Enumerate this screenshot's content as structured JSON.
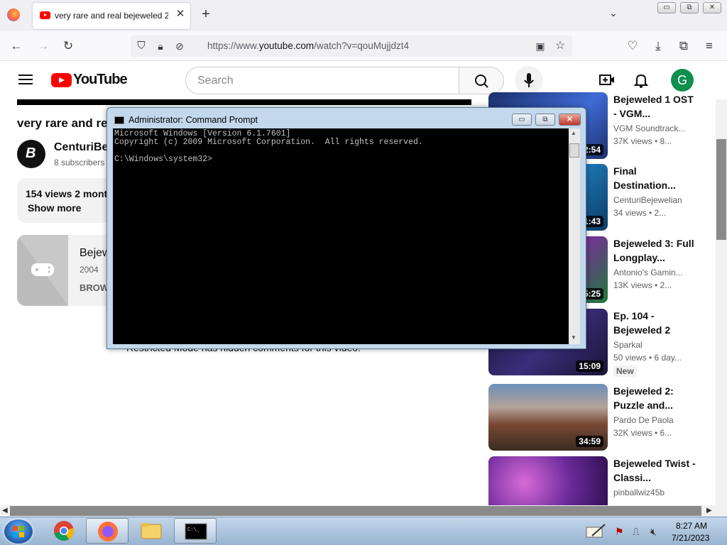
{
  "browser": {
    "tab_title": "very rare and real bejeweled 2 b",
    "tab_close": "✕",
    "new_tab": "+",
    "tab_list": "⌄",
    "window_controls": [
      "▭",
      "⧉",
      "✕"
    ],
    "url_prefix": "https://www.",
    "url_domain": "youtube.com",
    "url_path": "/watch?v=qouMujjdzt4",
    "icons": [
      "back-icon",
      "forward-icon",
      "reload-icon",
      "shield-icon",
      "lock-icon",
      "permissions-icon",
      "reader-icon",
      "star-icon",
      "pocket-icon",
      "download-icon",
      "extensions-icon",
      "menu-icon"
    ]
  },
  "youtube": {
    "logo_text": "YouTube",
    "search_placeholder": "Search",
    "avatar_letter": "G"
  },
  "video": {
    "title": "very rare and re",
    "channel": "CenturiBej",
    "subscribers": "8 subscribers",
    "views": "154 views  2 mont",
    "show_more": "Show more",
    "restricted_note": "Restricted Mode has hidden comments for this video."
  },
  "game": {
    "title": "Bejew",
    "year": "2004",
    "browse": "BROW"
  },
  "recommendations": [
    {
      "title": "Bejeweled 1 OST - VGM...",
      "channel": "VGM Soundtrack...",
      "meta": "37K views  • 8...",
      "duration": "2:54",
      "thumb_color": "#1b2f6b"
    },
    {
      "title": "Final Destination...",
      "channel": "CenturiBejewelian",
      "meta": "34 views  • 2...",
      "duration": "1:43",
      "thumb_color": "#0a3c66"
    },
    {
      "title": "Bejeweled 3: Full Longplay...",
      "channel": "Antonio's Gamin...",
      "meta": "13K views  • 2...",
      "duration": "5:25",
      "thumb_color": "#3a1250"
    },
    {
      "title": "Ep. 104 - Bejeweled 2",
      "channel": "Sparkal",
      "meta": "50 views  • 6 day...",
      "duration": "15:09",
      "badge": "New",
      "thumb_color": "#1a1438"
    },
    {
      "title": "Bejeweled 2: Puzzle and...",
      "channel": "Pardo De Paola",
      "meta": "32K views  • 6...",
      "duration": "34:59",
      "thumb_color": "#7a4a35"
    },
    {
      "title": "Bejeweled Twist - Classi...",
      "channel": "pinballwiz45b",
      "meta": "",
      "duration": "",
      "thumb_color": "#6a2a9a"
    }
  ],
  "cmd": {
    "title": "Administrator: Command Prompt",
    "buttons": [
      "▭",
      "⧉",
      "✕"
    ],
    "output": "Microsoft Windows [Version 6.1.7601]\nCopyright (c) 2009 Microsoft Corporation.  All rights reserved.\n\nC:\\Windows\\system32>"
  },
  "taskbar": {
    "time": "8:27 AM",
    "date": "7/21/2023"
  }
}
